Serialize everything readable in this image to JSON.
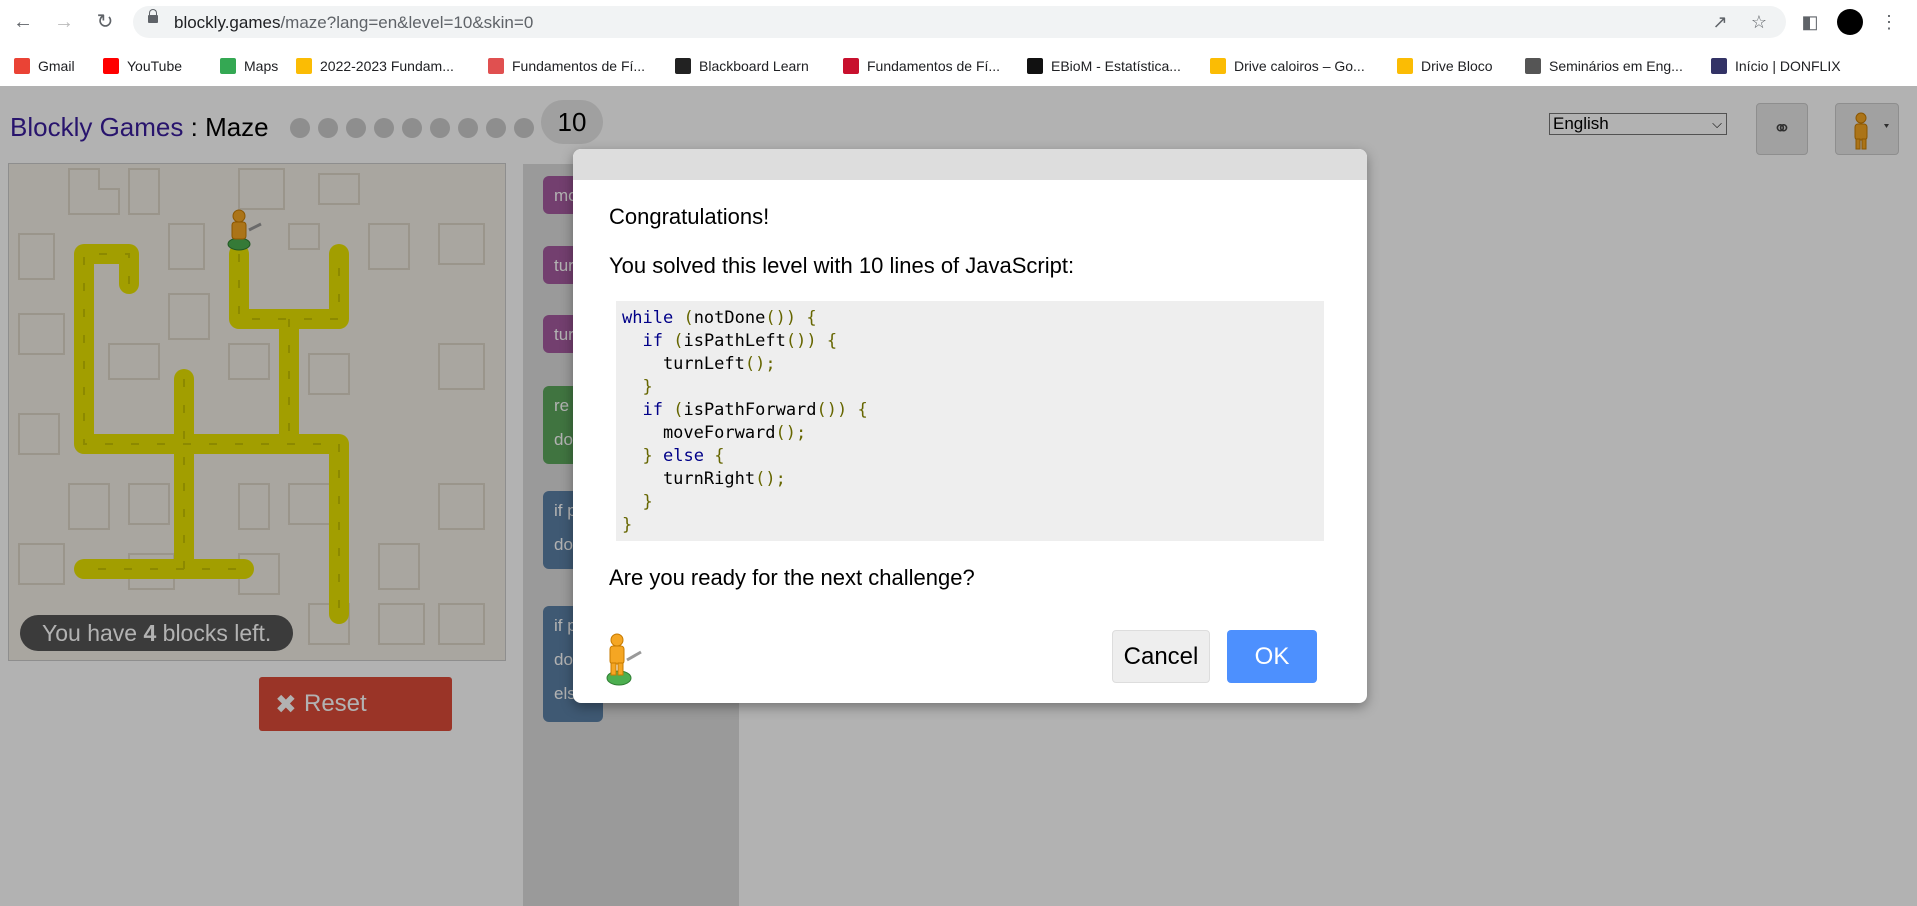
{
  "browser": {
    "url_host": "blockly.games",
    "url_rest": "/maze?lang=en&level=10&skin=0",
    "bookmarks": [
      {
        "label": "Gmail",
        "icon": "gmail-icon",
        "color": "#ea4335"
      },
      {
        "label": "YouTube",
        "icon": "youtube-icon",
        "color": "#ff0000"
      },
      {
        "label": "Maps",
        "icon": "maps-icon",
        "color": "#34a853"
      },
      {
        "label": "2022-2023 Fundam...",
        "icon": "drive-icon",
        "color": "#fbbc04"
      },
      {
        "label": "Fundamentos de Fí...",
        "icon": "ua-icon",
        "color": "#e05050"
      },
      {
        "label": "Blackboard Learn",
        "icon": "blackboard-icon",
        "color": "#222222"
      },
      {
        "label": "Fundamentos de Fí...",
        "icon": "p-icon",
        "color": "#c8102e"
      },
      {
        "label": "EBioM - Estatística...",
        "icon": "ebiom-icon",
        "color": "#111111"
      },
      {
        "label": "Drive caloiros – Go...",
        "icon": "drive-icon",
        "color": "#fbbc04"
      },
      {
        "label": "Drive Bloco",
        "icon": "drive-icon",
        "color": "#fbbc04"
      },
      {
        "label": "Seminários em Eng...",
        "icon": "microscope-icon",
        "color": "#555555"
      },
      {
        "label": "Início | DONFLIX",
        "icon": "donflix-icon",
        "color": "#333366"
      }
    ]
  },
  "game": {
    "title_link": "Blockly Games",
    "title_sep": " : ",
    "title_page": "Maze",
    "current_level": "10",
    "language": "English",
    "blocks_left_prefix": "You have ",
    "blocks_left_count": "4",
    "blocks_left_suffix": " blocks left.",
    "reset_label": "Reset",
    "toolbox_blocks": [
      {
        "label": "mo",
        "color": "#a55b9f"
      },
      {
        "label": "tur",
        "color": "#a55b9f"
      },
      {
        "label": "tur",
        "color": "#a55b9f"
      },
      {
        "label": "re",
        "label2": "do",
        "color": "#5ca65c"
      },
      {
        "label": "if p",
        "label2": "do",
        "color": "#5b80a5"
      },
      {
        "label": "if p",
        "label2": "do",
        "label3": "els",
        "color": "#5b80a5"
      }
    ]
  },
  "dialog": {
    "heading": "Congratulations!",
    "summary": "You solved this level with 10 lines of JavaScript:",
    "code_lines": [
      "while (notDone()) {",
      "  if (isPathLeft()) {",
      "    turnLeft();",
      "  }",
      "  if (isPathForward()) {",
      "    moveForward();",
      "  } else {",
      "    turnRight();",
      "  }",
      "}"
    ],
    "question": "Are you ready for the next challenge?",
    "cancel_label": "Cancel",
    "ok_label": "OK"
  },
  "colors": {
    "path": "#e8e300",
    "ok": "#4d90fe",
    "reset": "#dd4b39"
  }
}
